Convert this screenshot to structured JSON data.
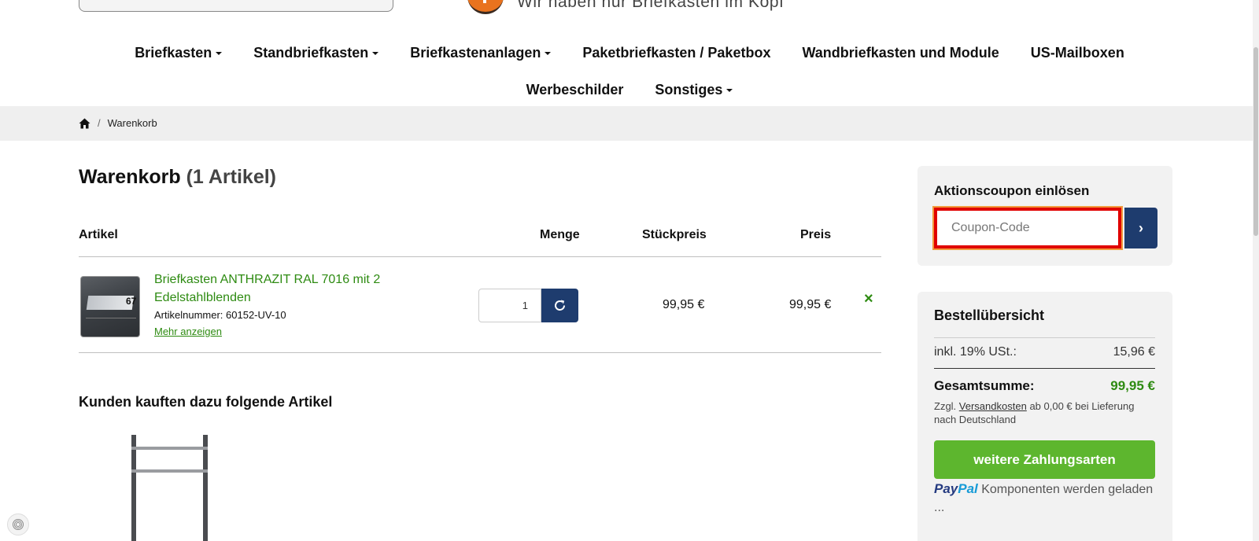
{
  "header": {
    "slogan": "Wir haben nur Briefkästen im Kopf"
  },
  "nav": {
    "row1": [
      {
        "label": "Briefkasten",
        "dropdown": true
      },
      {
        "label": "Standbriefkasten",
        "dropdown": true
      },
      {
        "label": "Briefkastenanlagen",
        "dropdown": true
      },
      {
        "label": "Paketbriefkasten / Paketbox",
        "dropdown": false
      },
      {
        "label": "Wandbriefkasten und Module",
        "dropdown": false
      },
      {
        "label": "US-Mailboxen",
        "dropdown": false
      }
    ],
    "row2": [
      {
        "label": "Werbeschilder",
        "dropdown": false
      },
      {
        "label": "Sonstiges",
        "dropdown": true
      }
    ]
  },
  "breadcrumb": {
    "current": "Warenkorb",
    "separator": "/"
  },
  "cart": {
    "title": "Warenkorb",
    "count_label": "(1 Artikel)",
    "columns": {
      "article": "Artikel",
      "quantity": "Menge",
      "unit_price": "Stückpreis",
      "price": "Preis"
    },
    "item": {
      "name": "Briefkasten ANTHRAZIT RAL 7016 mit 2 Edelstahlblenden",
      "sku": "Artikelnummer: 60152-UV-10",
      "more_link": "Mehr anzeigen",
      "quantity": "1",
      "unit_price": "99,95 €",
      "price": "99,95 €",
      "thumb_number": "67",
      "remove_symbol": "×"
    }
  },
  "also_bought": {
    "title": "Kunden kauften dazu folgende Artikel"
  },
  "coupon": {
    "title": "Aktionscoupon einlösen",
    "placeholder": "Coupon-Code",
    "submit_label": "›"
  },
  "summary": {
    "title": "Bestellübersicht",
    "tax_label": "inkl. 19% USt.:",
    "tax_value": "15,96 €",
    "total_label": "Gesamtsumme:",
    "total_value": "99,95 €",
    "shipping_prefix": "Zzgl.",
    "shipping_link": "Versandkosten",
    "shipping_suffix": "ab 0,00 € bei Lieferung nach Deutschland",
    "pay_button": "weitere Zahlungsarten",
    "paypal_a": "Pay",
    "paypal_b": "Pal",
    "paypal_text": "Komponenten werden geladen ..."
  },
  "colors": {
    "accent_green": "#2e8b12",
    "button_green": "#5db62e",
    "navy": "#1e3c6e",
    "focus_red": "#e00000"
  }
}
